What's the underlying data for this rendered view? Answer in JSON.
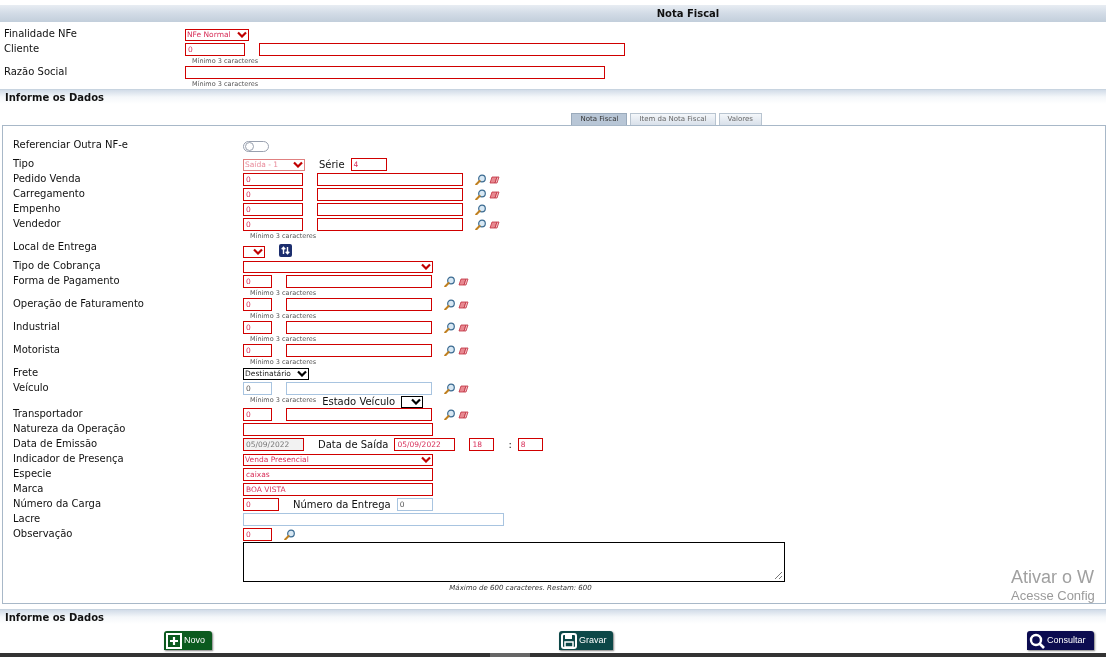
{
  "header": {
    "title": "Nota Fiscal"
  },
  "top_rows": [
    {
      "label": "Finalidade NFe",
      "controls": [
        {
          "kind": "select",
          "value": "NFe Normal",
          "required": true
        }
      ]
    },
    {
      "label": "Cliente",
      "controls": [
        {
          "kind": "code-input",
          "value": "0",
          "required": true
        },
        {
          "kind": "full-input",
          "required": true
        }
      ],
      "hint": "Mínimo 3 caracteres"
    },
    {
      "label": "Razão Social",
      "controls": [
        {
          "kind": "razao-input",
          "required": true
        }
      ],
      "hint": "Mínimo 3 caracteres"
    }
  ],
  "section_title": "Informe os Dados",
  "tabs": [
    {
      "label": "Nota Fiscal",
      "selected": true
    },
    {
      "label": "Item da Nota Fiscal",
      "selected": false
    },
    {
      "label": "Valores",
      "selected": false
    }
  ],
  "rows": [
    {
      "label": "Referenciar Outra NF-e",
      "controls": [
        {
          "kind": "toggle",
          "on": false
        }
      ]
    },
    {
      "label": "Tipo",
      "controls": [
        {
          "kind": "select",
          "value": "Saída - 1",
          "required": true,
          "disabled": true
        },
        {
          "kind": "label",
          "text": "Série"
        },
        {
          "kind": "medium-input",
          "value": "4",
          "required": true
        }
      ]
    },
    {
      "label": "Pedido Venda",
      "controls": [
        {
          "kind": "code-input",
          "value": "0",
          "required": true
        },
        {
          "kind": "lookup-input",
          "required": true
        },
        {
          "kind": "lookup-button"
        },
        {
          "kind": "clear-button"
        }
      ]
    },
    {
      "label": "Carregamento",
      "controls": [
        {
          "kind": "code-input",
          "value": "0",
          "required": true
        },
        {
          "kind": "lookup-input",
          "required": true
        },
        {
          "kind": "lookup-button"
        },
        {
          "kind": "clear-button"
        }
      ]
    },
    {
      "label": "Empenho",
      "controls": [
        {
          "kind": "code-input",
          "value": "0",
          "required": true
        },
        {
          "kind": "lookup-input",
          "required": true
        },
        {
          "kind": "lookup-button"
        }
      ]
    },
    {
      "label": "Vendedor",
      "controls": [
        {
          "kind": "code-input",
          "value": "0",
          "required": true
        },
        {
          "kind": "lookup-input",
          "required": true
        },
        {
          "kind": "lookup-button"
        },
        {
          "kind": "clear-button"
        }
      ],
      "hint": "Mínimo 3 caracteres"
    },
    {
      "label": "Local de Entrega",
      "controls": [
        {
          "kind": "select",
          "required": true
        },
        {
          "kind": "reload-button"
        }
      ]
    },
    {
      "label": "Tipo de Cobrança",
      "controls": [
        {
          "kind": "wide-select",
          "required": true
        }
      ]
    },
    {
      "label": "Forma de Pagamento",
      "controls": [
        {
          "kind": "short-input",
          "value": "0",
          "required": true
        },
        {
          "kind": "lookup-input",
          "required": true
        },
        {
          "kind": "lookup-button"
        },
        {
          "kind": "clear-button"
        }
      ],
      "hint": "Mínimo 3 caracteres"
    },
    {
      "label": "Operação de Faturamento",
      "controls": [
        {
          "kind": "short-input",
          "value": "0",
          "required": true
        },
        {
          "kind": "lookup-input",
          "required": true
        },
        {
          "kind": "lookup-button"
        },
        {
          "kind": "clear-button"
        }
      ],
      "hint": "Mínimo 3 caracteres"
    },
    {
      "label": "Industrial",
      "controls": [
        {
          "kind": "short-input",
          "value": "0",
          "required": true
        },
        {
          "kind": "lookup-input",
          "required": true
        },
        {
          "kind": "lookup-button"
        },
        {
          "kind": "clear-button"
        }
      ],
      "hint": "Mínimo 3 caracteres"
    },
    {
      "label": "Motorista",
      "controls": [
        {
          "kind": "short-input",
          "value": "0",
          "required": true
        },
        {
          "kind": "lookup-input",
          "required": true
        },
        {
          "kind": "lookup-button"
        },
        {
          "kind": "clear-button"
        }
      ],
      "hint": "Mínimo 3 caracteres"
    },
    {
      "label": "Frete",
      "controls": [
        {
          "kind": "select",
          "value": "Destinatário",
          "required": false
        }
      ]
    },
    {
      "label": "Veículo",
      "controls": [
        {
          "kind": "short-input",
          "value": "0",
          "required": false
        },
        {
          "kind": "lookup-input",
          "required": false
        },
        {
          "kind": "lookup-button"
        },
        {
          "kind": "clear-button"
        }
      ],
      "hint": "Mínimo 3 caracteres",
      "hint_controls": [
        {
          "kind": "label",
          "text": "Estado Veículo"
        },
        {
          "kind": "select",
          "required": false
        }
      ]
    },
    {
      "label": "Transportador",
      "controls": [
        {
          "kind": "short-input",
          "value": "0",
          "required": true
        },
        {
          "kind": "lookup-input",
          "required": true
        },
        {
          "kind": "lookup-button"
        },
        {
          "kind": "clear-button"
        }
      ]
    },
    {
      "label": "Natureza da Operação",
      "controls": [
        {
          "kind": "long-input",
          "required": true
        }
      ]
    },
    {
      "label": "Data de Emissão",
      "controls": [
        {
          "kind": "date-input",
          "value": "05/09/2022",
          "required": true,
          "disabled": true
        },
        {
          "kind": "label",
          "text": "Data de Saída"
        },
        {
          "kind": "date-input",
          "value": "05/09/2022",
          "required": true
        },
        {
          "kind": "time-input",
          "value": "18",
          "required": true
        },
        {
          "kind": "label",
          "text": ":"
        },
        {
          "kind": "time-input",
          "value": "8",
          "required": true
        }
      ]
    },
    {
      "label": "Indicador de Presença",
      "controls": [
        {
          "kind": "wide-select",
          "value": "Venda Presencial",
          "required": true
        }
      ]
    },
    {
      "label": "Especie",
      "controls": [
        {
          "kind": "long-input",
          "value": "caixas",
          "required": true
        }
      ]
    },
    {
      "label": "Marca",
      "controls": [
        {
          "kind": "long-input",
          "value": "BOA VISTA",
          "required": true
        }
      ]
    },
    {
      "label": "Número da Carga",
      "controls": [
        {
          "kind": "medium-input",
          "value": "0",
          "required": true
        },
        {
          "kind": "label",
          "text": "Número da Entrega"
        },
        {
          "kind": "medium-input",
          "value": "0",
          "required": false
        }
      ]
    },
    {
      "label": "Lacre",
      "controls": [
        {
          "kind": "wide-input",
          "required": false
        }
      ]
    },
    {
      "label": "Observação",
      "controls": [
        {
          "kind": "short-input",
          "value": "0",
          "required": true
        },
        {
          "kind": "lookup-button"
        }
      ]
    },
    {
      "controls": [
        {
          "kind": "textarea"
        }
      ]
    }
  ],
  "counter": "Máximo de 600 caracteres. Restam: 600",
  "footer_title": "Informe os Dados",
  "buttons": [
    {
      "kind": "new",
      "label": "Novo"
    },
    {
      "kind": "save",
      "label": "Gravar"
    },
    {
      "kind": "search",
      "label": "Consultar"
    }
  ],
  "os_notice": {
    "title": "Ativar o W",
    "subtitle": "Acesse Config"
  }
}
